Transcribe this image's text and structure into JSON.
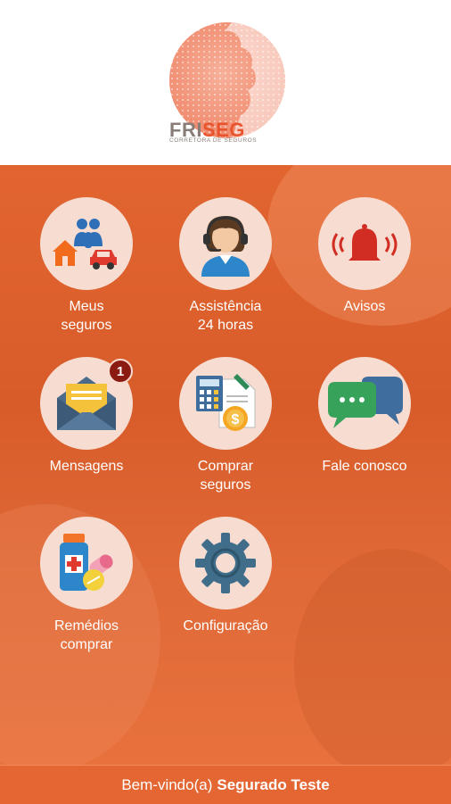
{
  "brand": {
    "name_part1": "FRI",
    "name_part2": "SEG",
    "tagline": "CORRETORA DE SEGUROS"
  },
  "colors": {
    "accent": "#e8542d",
    "background": "#d85c2a",
    "tile": "#f6dcd1",
    "badge": "#8b1a12"
  },
  "menu": [
    {
      "id": "meus-seguros",
      "line1": "Meus",
      "line2": "seguros",
      "icon": "family-house-car-icon"
    },
    {
      "id": "assistencia",
      "line1": "Assistência",
      "line2": "24 horas",
      "icon": "headset-agent-icon"
    },
    {
      "id": "avisos",
      "line1": "Avisos",
      "line2": "",
      "icon": "bell-icon"
    },
    {
      "id": "mensagens",
      "line1": "Mensagens",
      "line2": "",
      "icon": "envelope-icon",
      "badge": "1"
    },
    {
      "id": "comprar-seguros",
      "line1": "Comprar",
      "line2": "seguros",
      "icon": "calculator-coin-icon"
    },
    {
      "id": "fale-conosco",
      "line1": "Fale conosco",
      "line2": "",
      "icon": "chat-bubbles-icon"
    },
    {
      "id": "remedios",
      "line1": "Remédios",
      "line2": "comprar",
      "icon": "medicine-icon"
    },
    {
      "id": "configuracao",
      "line1": "Configuração",
      "line2": "",
      "icon": "gear-icon"
    }
  ],
  "footer": {
    "greeting": "Bem-vindo(a)",
    "user": "Segurado Teste"
  }
}
